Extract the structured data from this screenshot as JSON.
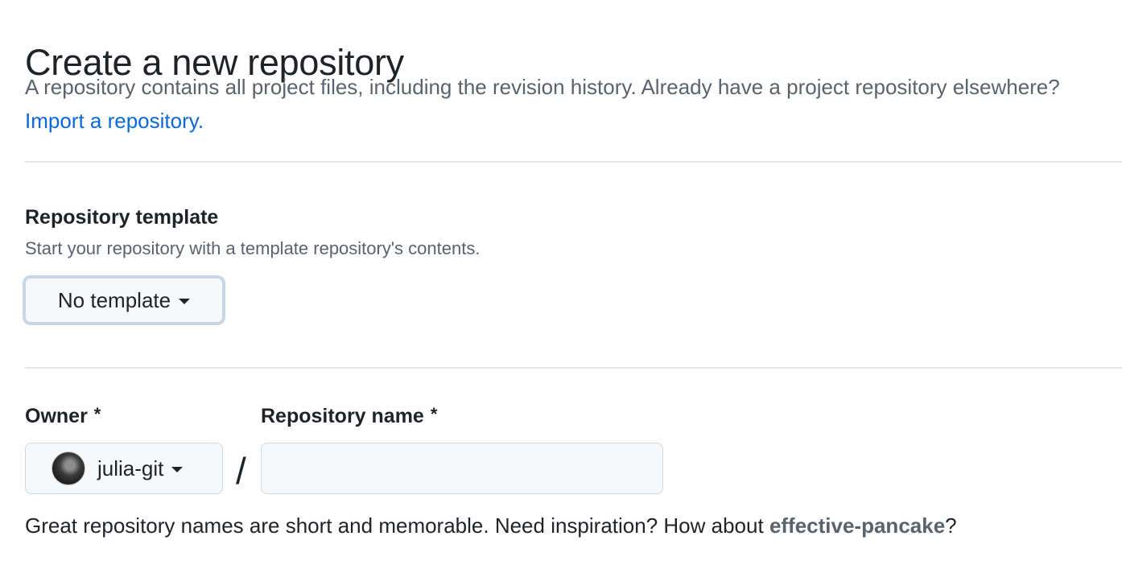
{
  "header": {
    "title": "Create a new repository",
    "description": "A repository contains all project files, including the revision history. Already have a project repository elsewhere?",
    "import_link": "Import a repository."
  },
  "template_section": {
    "heading": "Repository template",
    "description": "Start your repository with a template repository's contents.",
    "button_label": "No template"
  },
  "owner_section": {
    "owner_label": "Owner",
    "repo_label": "Repository name",
    "required_marker": "*",
    "owner_value": "julia-git",
    "separator": "/",
    "repo_name_value": "",
    "repo_name_placeholder": ""
  },
  "hint": {
    "prefix": "Great repository names are short and memorable. Need inspiration? How about",
    "suggestion": "effective-pancake",
    "suffix": "?"
  },
  "colors": {
    "link": "#0969da",
    "muted_text": "#59636e",
    "focus_ring": "#c9d6e6"
  },
  "icons": {
    "dropdown_caret": "caret-down-icon",
    "owner_avatar": "avatar"
  }
}
